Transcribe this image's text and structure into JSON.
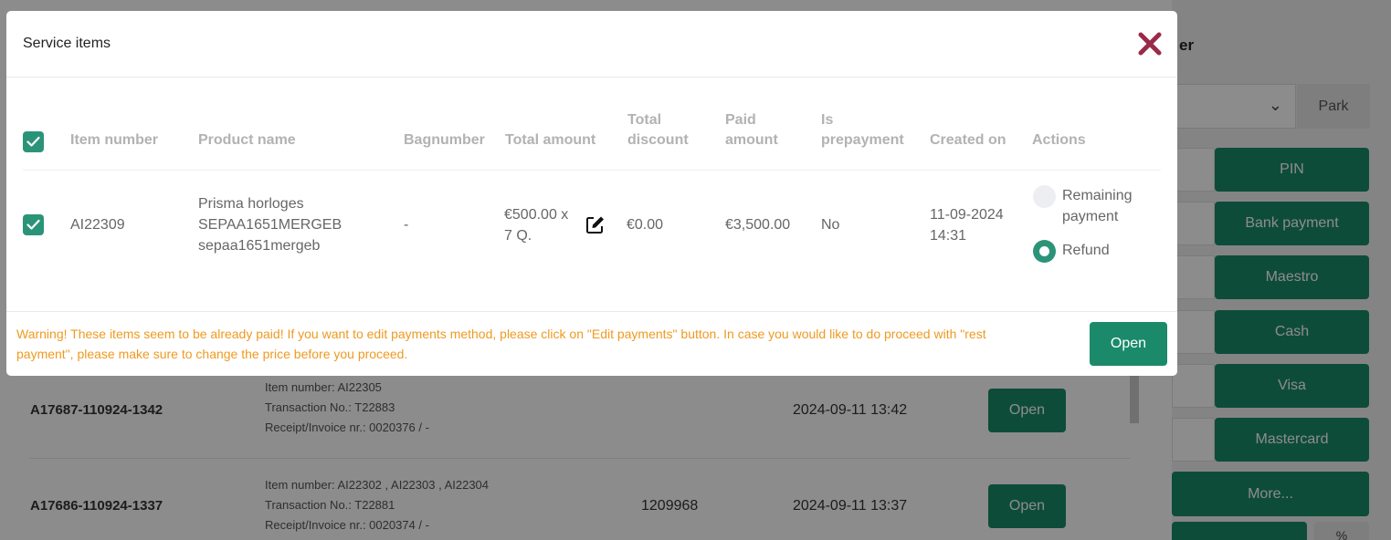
{
  "modal": {
    "title": "Service items",
    "columns": [
      "Item number",
      "Product name",
      "Bagnumber",
      "Total amount",
      "Total discount",
      "Paid amount",
      "Is prepayment",
      "Created on",
      "Actions"
    ],
    "row": {
      "item_number": "AI22309",
      "product_lines": [
        "Prisma horloges",
        "SEPAA1651MERGEB",
        "sepaa1651mergeb"
      ],
      "bagnumber": "-",
      "total_amount_lines": [
        "€500.00 x",
        "7 Q."
      ],
      "total_discount": "€0.00",
      "paid_amount": "€3,500.00",
      "is_prepayment": "No",
      "created_on_lines": [
        "11-09-2024",
        "14:31"
      ],
      "actions": {
        "remaining_lines": [
          "Remaining",
          "payment"
        ],
        "refund": "Refund",
        "selected": "Refund"
      }
    },
    "warning_lines": [
      "Warning! These items seem to be already paid! If you want to edit payments method, please click on \"Edit payments\" button. In case you would like to do proceed with \"rest",
      "payment\", please make sure to change the price before you proceed."
    ],
    "open_label": "Open"
  },
  "background": {
    "right_panel": {
      "title": "er",
      "park_label": "Park",
      "payment_methods": [
        "PIN",
        "Bank payment",
        "Maestro",
        "Cash",
        "Visa",
        "Mastercard"
      ],
      "more_label": "More...",
      "bottom_btn2": "%"
    },
    "orders": [
      {
        "id": "A17687-110924-1342",
        "item_numbers": "Item number: AI22305",
        "transaction": "Transaction No.: T22883",
        "receipt": "Receipt/Invoice nr.: 0020376 / -",
        "number": "",
        "date": "2024-09-11 13:42",
        "open": "Open"
      },
      {
        "id": "A17686-110924-1337",
        "item_numbers": "Item number: AI22302 , AI22303 , AI22304",
        "transaction": "Transaction No.: T22881",
        "receipt": "Receipt/Invoice nr.: 0020374 / -",
        "number": "1209968",
        "date": "2024-09-11 13:37",
        "open": "Open"
      }
    ]
  }
}
